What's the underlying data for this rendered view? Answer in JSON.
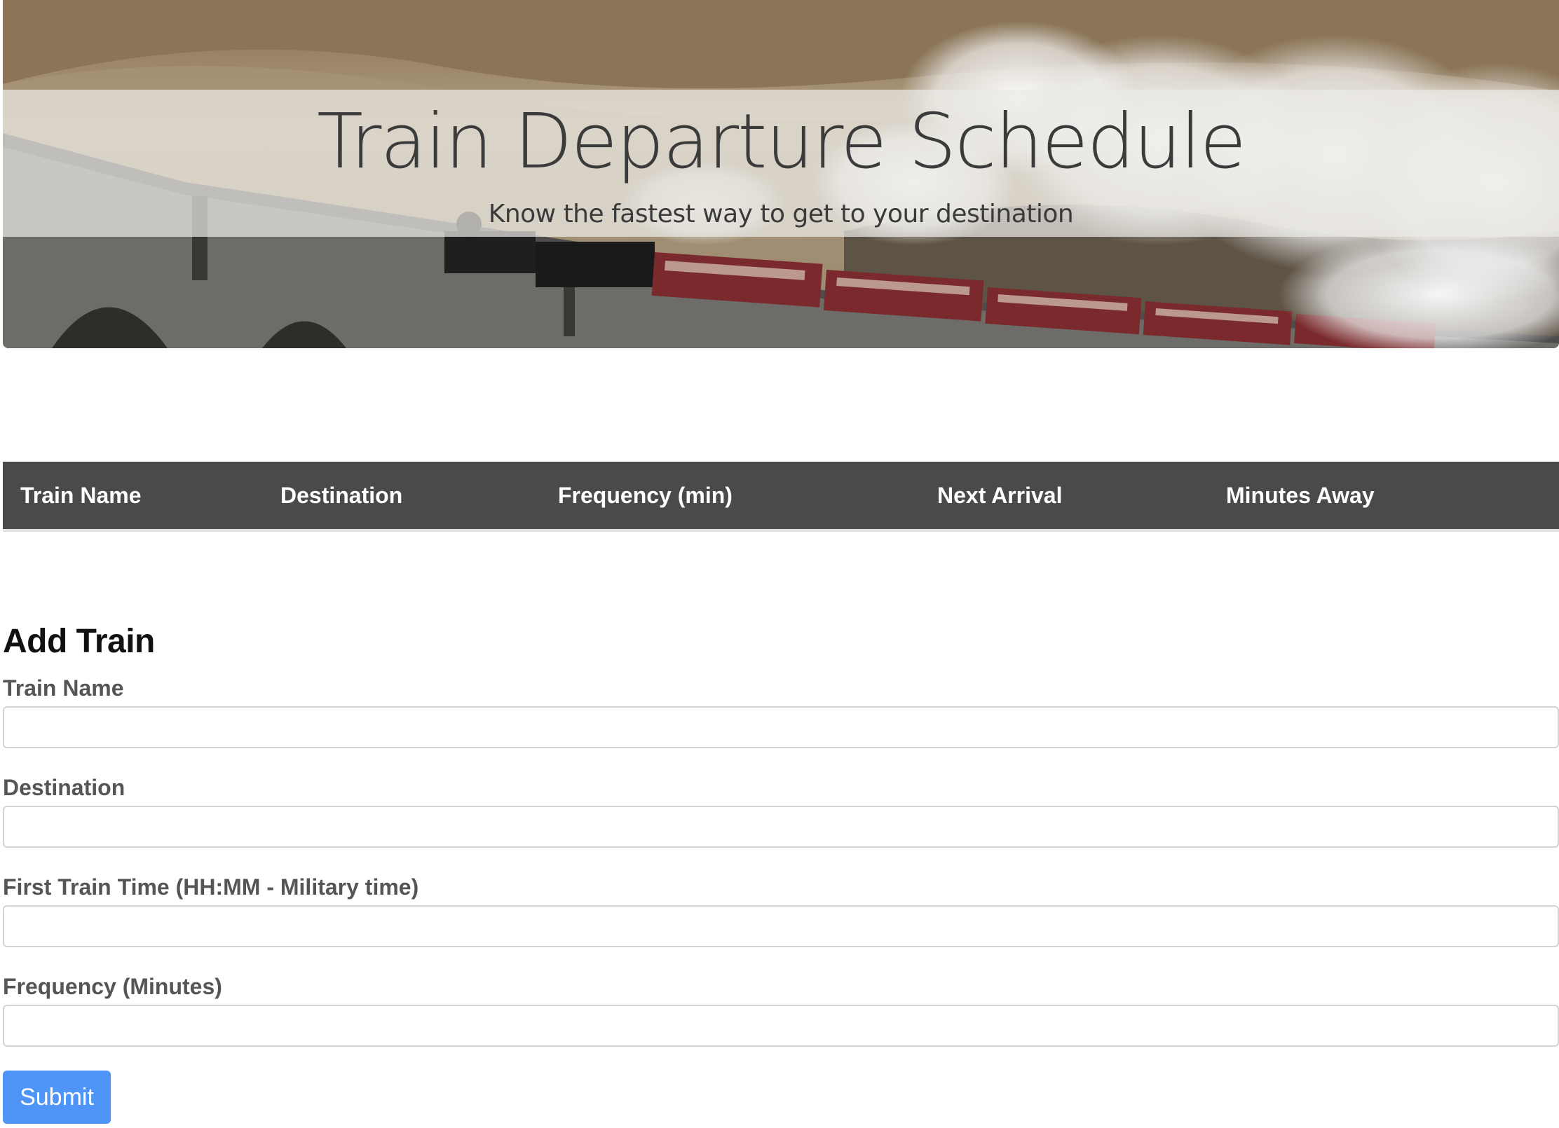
{
  "hero": {
    "title": "Train Departure Schedule",
    "subtitle": "Know the fastest way to get to your destination"
  },
  "schedule_table": {
    "columns": [
      "Train Name",
      "Destination",
      "Frequency (min)",
      "Next Arrival",
      "Minutes Away"
    ],
    "rows": []
  },
  "add_train_form": {
    "title": "Add Train",
    "fields": [
      {
        "label": "Train Name",
        "value": ""
      },
      {
        "label": "Destination",
        "value": ""
      },
      {
        "label": "First Train Time (HH:MM - Military time)",
        "value": ""
      },
      {
        "label": "Frequency (Minutes)",
        "value": ""
      }
    ],
    "submit_label": "Submit"
  },
  "colors": {
    "table_header_bg": "#4a4a4a",
    "submit_bg": "#4f95f7",
    "label_text": "#555555"
  }
}
